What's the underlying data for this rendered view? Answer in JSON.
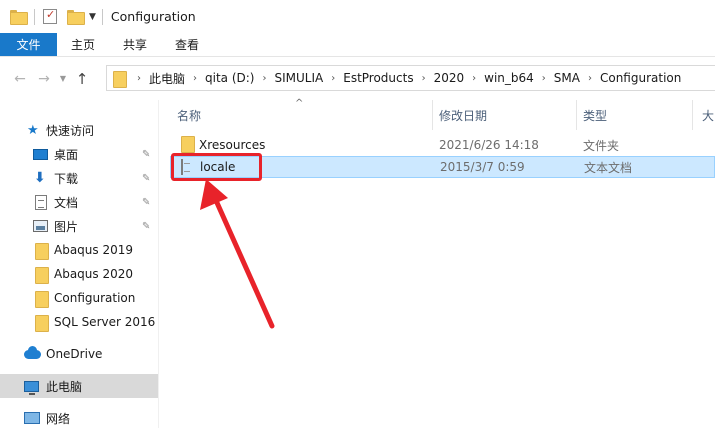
{
  "window": {
    "title": "Configuration"
  },
  "ribbon": {
    "tabs": [
      "文件",
      "主页",
      "共享",
      "查看"
    ]
  },
  "nav": {
    "breadcrumbs": [
      "此电脑",
      "qita (D:)",
      "SIMULIA",
      "EstProducts",
      "2020",
      "win_b64",
      "SMA",
      "Configuration"
    ]
  },
  "sidebar": {
    "quick_access": "快速访问",
    "items": [
      {
        "label": "桌面",
        "icon": "desktop-icon",
        "pinned": true
      },
      {
        "label": "下载",
        "icon": "download-icon",
        "pinned": true
      },
      {
        "label": "文档",
        "icon": "documents-icon",
        "pinned": true
      },
      {
        "label": "图片",
        "icon": "pictures-icon",
        "pinned": true
      },
      {
        "label": "Abaqus 2019",
        "icon": "folder-icon",
        "pinned": false
      },
      {
        "label": "Abaqus 2020",
        "icon": "folder-icon",
        "pinned": false
      },
      {
        "label": "Configuration",
        "icon": "folder-icon",
        "pinned": false
      },
      {
        "label": "SQL Server 2016",
        "icon": "folder-icon",
        "pinned": false
      }
    ],
    "onedrive": "OneDrive",
    "this_pc": "此电脑",
    "network": "网络"
  },
  "columns": {
    "name": "名称",
    "modified": "修改日期",
    "type": "类型",
    "size": "大"
  },
  "files": [
    {
      "name": "Xresources",
      "modified": "2021/6/26 14:18",
      "type": "文件夹",
      "icon": "folder-icon",
      "selected": false
    },
    {
      "name": "locale",
      "modified": "2015/3/7 0:59",
      "type": "文本文档",
      "icon": "text-file-icon",
      "selected": true
    }
  ],
  "colors": {
    "accent": "#1979ca",
    "selection": "#cce8ff",
    "annotation": "#e8232a"
  }
}
